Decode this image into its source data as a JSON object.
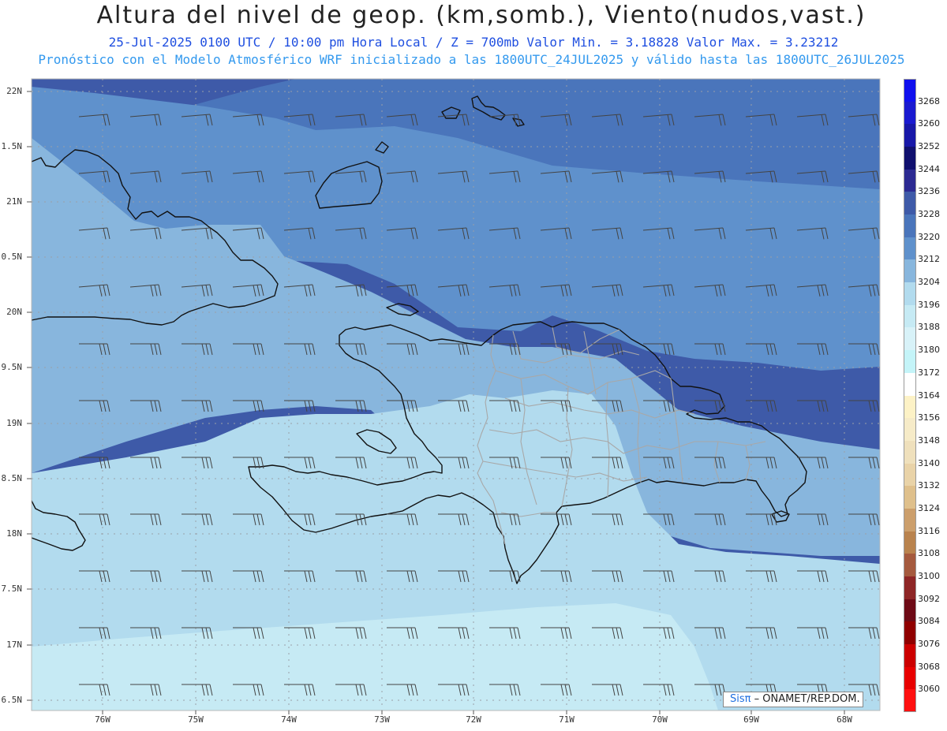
{
  "header": {
    "title": "Altura del nivel de geop. (km,somb.), Viento(nudos,vast.)",
    "subtitle_1": "25-Jul-2025  0100 UTC / 10:00 pm Hora Local / Z = 700mb   Valor Min. = 3.18828  Valor Max. = 3.23212",
    "subtitle_2": "Pronóstico con el Modelo Atmosférico WRF inicializado a las 1800UTC_24JUL2025 y válido hasta las  1800UTC_26JUL2025"
  },
  "map": {
    "lat_labels": [
      "22N",
      "1.5N",
      "21N",
      "0.5N",
      "20N",
      "9.5N",
      "19N",
      "8.5N",
      "18N",
      "7.5N",
      "17N",
      "6.5N"
    ],
    "lon_labels": [
      "76W",
      "75W",
      "74W",
      "73W",
      "72W",
      "71W",
      "70W",
      "69W",
      "68W"
    ],
    "colors": {
      "band_3228": "#3e5aa8",
      "band_3220": "#4a75bb",
      "band_3212": "#5f91cc",
      "band_3204": "#88b6dd",
      "band_3196": "#b2dbee",
      "band_3188": "#c6eaf4",
      "coast": "#111111",
      "provinces": "#a8a8a8",
      "grid": "#9aa0a8",
      "barbs": "#444444"
    }
  },
  "colorbar": {
    "labels": [
      "3268",
      "3260",
      "3252",
      "3244",
      "3236",
      "3228",
      "3220",
      "3212",
      "3204",
      "3196",
      "3188",
      "3180",
      "3172",
      "3164",
      "3156",
      "3148",
      "3140",
      "3132",
      "3124",
      "3116",
      "3108",
      "3100",
      "3092",
      "3084",
      "3076",
      "3068",
      "3060"
    ],
    "colors": [
      "#1010ee",
      "#1a1ad0",
      "#1818a8",
      "#10106e",
      "#2c2a92",
      "#3e5aa8",
      "#4a75bb",
      "#5f91cc",
      "#88b6dd",
      "#b2dbee",
      "#c6eaf4",
      "#d8f2f8",
      "#c4f4f8",
      "#ffffff",
      "#fdf2c6",
      "#f6ebc8",
      "#efe0bc",
      "#e9d3a8",
      "#dfc08c",
      "#cc9f6c",
      "#b9834e",
      "#a55a3e",
      "#8e2626",
      "#6e0a16",
      "#900000",
      "#cc0000",
      "#e80000",
      "#ff1010"
    ]
  },
  "credit": {
    "sis": "Sisπ",
    "rest": "– ONAMET/REP.DOM."
  }
}
